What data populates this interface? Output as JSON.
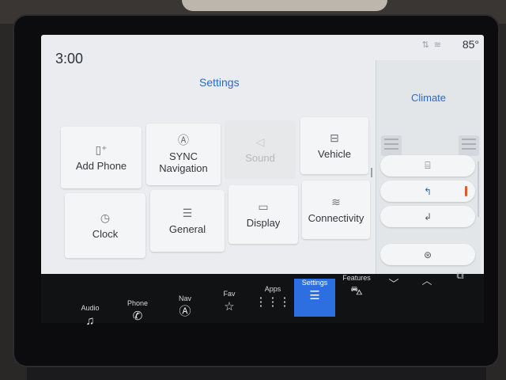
{
  "status": {
    "time": "3:00",
    "temperature": "85°",
    "icons": [
      "signal-icon",
      "wifi-icon"
    ]
  },
  "settings": {
    "title": "Settings",
    "tiles": [
      {
        "label": "Add Phone",
        "icon": "phone-add-icon",
        "enabled": true
      },
      {
        "label": "SYNC Navigation",
        "icon": "navigation-icon",
        "enabled": true
      },
      {
        "label": "Sound",
        "icon": "speaker-icon",
        "enabled": false
      },
      {
        "label": "Vehicle",
        "icon": "vehicle-settings-icon",
        "enabled": true
      },
      {
        "label": "Clock",
        "icon": "clock-icon",
        "enabled": true
      },
      {
        "label": "General",
        "icon": "sliders-icon",
        "enabled": true
      },
      {
        "label": "Display",
        "icon": "display-icon",
        "enabled": true
      },
      {
        "label": "Connectivity",
        "icon": "wifi-icon",
        "enabled": true
      }
    ],
    "pager": {
      "current": 1,
      "total": 2
    }
  },
  "climate": {
    "title": "Climate",
    "buttons": [
      {
        "icon": "rear-defrost-icon",
        "active": false
      },
      {
        "icon": "airflow-face-icon",
        "active": true
      },
      {
        "icon": "airflow-floor-icon",
        "active": false
      },
      {
        "icon": "heated-steering-icon",
        "active": false
      }
    ]
  },
  "nav": [
    {
      "label": "Audio",
      "icon": "music-note-icon",
      "active": false
    },
    {
      "label": "Phone",
      "icon": "phone-icon",
      "active": false
    },
    {
      "label": "Nav",
      "icon": "navigation-icon",
      "active": false
    },
    {
      "label": "Fav",
      "icon": "star-icon",
      "active": false
    },
    {
      "label": "Apps",
      "icon": "apps-grid-icon",
      "active": false
    },
    {
      "label": "Settings",
      "icon": "sliders-icon",
      "active": true
    },
    {
      "label": "Features",
      "icon": "car-icon",
      "active": false
    }
  ],
  "controls": [
    "chevron-down-icon",
    "chevron-up-icon",
    "split-screen-icon"
  ],
  "colors": {
    "accent": "#2d67c7",
    "nav_active": "#2d6fe0",
    "screen_bg": "#eaecef",
    "indicator": "#e0592a"
  }
}
